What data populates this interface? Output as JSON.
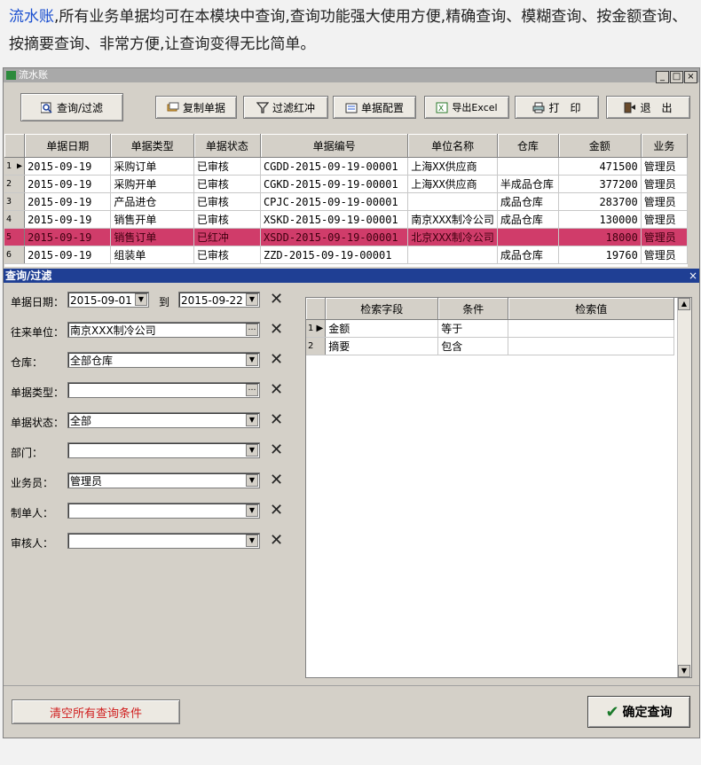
{
  "intro": {
    "highlight": "流水账",
    "text": ",所有业务单据均可在本模块中查询,查询功能强大使用方便,精确查询、模糊查询、按金额查询、按摘要查询、非常方便,让查询变得无比简单。"
  },
  "window": {
    "title": "流水账",
    "controls": [
      "_",
      "□",
      "×"
    ]
  },
  "toolbar": {
    "query_filter": "查询/过滤",
    "copy_doc": "复制单据",
    "filter_red": "过滤红冲",
    "doc_config": "单据配置",
    "export_excel": "导出Excel",
    "print": "打　印",
    "exit": "退　出"
  },
  "grid": {
    "columns": [
      "单据日期",
      "单据类型",
      "单据状态",
      "单据编号",
      "单位名称",
      "仓库",
      "金额",
      "业务"
    ],
    "rows": [
      {
        "ind": "1 ▶",
        "date": "2015-09-19",
        "type": "采购订单",
        "status": "已审核",
        "no": "CGDD-2015-09-19-00001",
        "unit": "上海XX供应商",
        "wh": "",
        "amount": "471500",
        "staff": "管理员"
      },
      {
        "ind": "2",
        "date": "2015-09-19",
        "type": "采购开单",
        "status": "已审核",
        "no": "CGKD-2015-09-19-00001",
        "unit": "上海XX供应商",
        "wh": "半成品仓库",
        "amount": "377200",
        "staff": "管理员"
      },
      {
        "ind": "3",
        "date": "2015-09-19",
        "type": "产品进仓",
        "status": "已审核",
        "no": "CPJC-2015-09-19-00001",
        "unit": "",
        "wh": "成品仓库",
        "amount": "283700",
        "staff": "管理员"
      },
      {
        "ind": "4",
        "date": "2015-09-19",
        "type": "销售开单",
        "status": "已审核",
        "no": "XSKD-2015-09-19-00001",
        "unit": "南京XXX制冷公司",
        "wh": "成品仓库",
        "amount": "130000",
        "staff": "管理员"
      },
      {
        "ind": "5",
        "date": "2015-09-19",
        "type": "销售订单",
        "status": "已红冲",
        "no": "XSDD-2015-09-19-00001",
        "unit": "北京XXX制冷公司",
        "wh": "",
        "amount": "18000",
        "staff": "管理员"
      },
      {
        "ind": "6",
        "date": "2015-09-19",
        "type": "组装单",
        "status": "已审核",
        "no": "ZZD-2015-09-19-00001",
        "unit": "",
        "wh": "成品仓库",
        "amount": "19760",
        "staff": "管理员"
      }
    ],
    "selected_row": 4
  },
  "panel": {
    "title": "查询/过滤",
    "close": "×",
    "fields": {
      "date_label": "单据日期：",
      "date_from": "2015-09-01",
      "to_label": "到",
      "date_to": "2015-09-22",
      "unit_label": "往来单位：",
      "unit_value": "南京XXX制冷公司",
      "wh_label": "仓库：",
      "wh_value": "全部仓库",
      "type_label": "单据类型：",
      "type_value": "",
      "status_label": "单据状态：",
      "status_value": "全部",
      "dept_label": "部门：",
      "dept_value": "",
      "staff_label": "业务员：",
      "staff_value": "管理员",
      "maker_label": "制单人：",
      "maker_value": "",
      "auditor_label": "审核人：",
      "auditor_value": ""
    },
    "criteria": {
      "columns": [
        "检索字段",
        "条件",
        "检索值"
      ],
      "rows": [
        {
          "ind": "1 ▶",
          "field": "金额",
          "cond": "等于",
          "val": ""
        },
        {
          "ind": "2",
          "field": "摘要",
          "cond": "包含",
          "val": ""
        }
      ]
    },
    "clear_button": "清空所有查询条件",
    "confirm_button": "确定查询"
  }
}
